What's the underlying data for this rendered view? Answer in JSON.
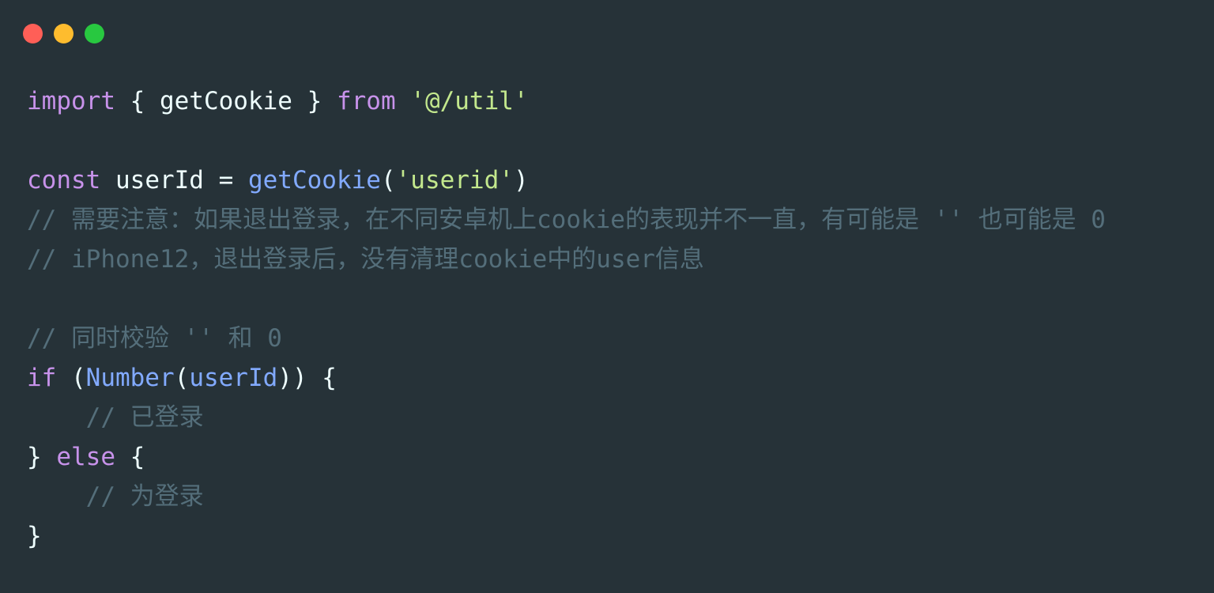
{
  "window": {
    "controls": [
      {
        "name": "close-button",
        "color": "#ff5f57"
      },
      {
        "name": "minimize-button",
        "color": "#febc2e"
      },
      {
        "name": "maximize-button",
        "color": "#28c840"
      }
    ]
  },
  "colors": {
    "background": "#263238",
    "keyword": "#c792ea",
    "function": "#82aaff",
    "string": "#c3e88d",
    "comment": "#546e7a",
    "text": "#eeffff"
  },
  "code": {
    "lines": [
      [
        {
          "t": "import",
          "c": "keyword"
        },
        {
          "t": " { getCookie } ",
          "c": "text"
        },
        {
          "t": "from",
          "c": "keyword"
        },
        {
          "t": " ",
          "c": "text"
        },
        {
          "t": "'@/util'",
          "c": "string"
        }
      ],
      [],
      [
        {
          "t": "const",
          "c": "keyword"
        },
        {
          "t": " userId = ",
          "c": "text"
        },
        {
          "t": "getCookie",
          "c": "function"
        },
        {
          "t": "(",
          "c": "text"
        },
        {
          "t": "'userid'",
          "c": "string"
        },
        {
          "t": ")",
          "c": "text"
        }
      ],
      [
        {
          "t": "// 需要注意：如果退出登录，在不同安卓机上cookie的表现并不一直，有可能是 '' 也可能是 0",
          "c": "comment"
        }
      ],
      [
        {
          "t": "// iPhone12，退出登录后，没有清理cookie中的user信息",
          "c": "comment"
        }
      ],
      [],
      [
        {
          "t": "// 同时校验 '' 和 0",
          "c": "comment"
        }
      ],
      [
        {
          "t": "if",
          "c": "keyword"
        },
        {
          "t": " (",
          "c": "text"
        },
        {
          "t": "Number",
          "c": "function"
        },
        {
          "t": "(",
          "c": "text"
        },
        {
          "t": "userId",
          "c": "function"
        },
        {
          "t": ")) {",
          "c": "text"
        }
      ],
      [
        {
          "t": "    ",
          "c": "text"
        },
        {
          "t": "// 已登录",
          "c": "comment"
        }
      ],
      [
        {
          "t": "} ",
          "c": "text"
        },
        {
          "t": "else",
          "c": "keyword"
        },
        {
          "t": " {",
          "c": "text"
        }
      ],
      [
        {
          "t": "    ",
          "c": "text"
        },
        {
          "t": "// 为登录",
          "c": "comment"
        }
      ],
      [
        {
          "t": "}",
          "c": "text"
        }
      ]
    ]
  }
}
